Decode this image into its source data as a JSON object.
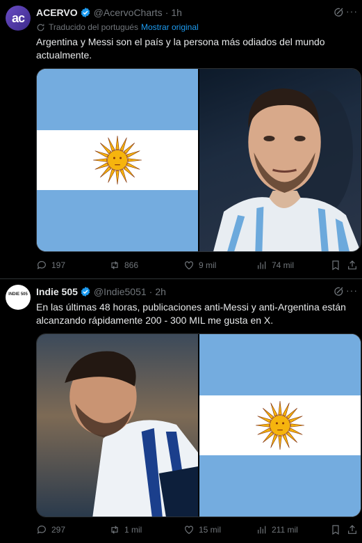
{
  "tweets": [
    {
      "avatar_text": "ac",
      "name": "ACERVO",
      "handle": "@AcervoCharts",
      "separator": "·",
      "time": "1h",
      "translated_note": "Traducido del portugués",
      "translated_link": "Mostrar original",
      "text": "Argentina y Messi son el país y la persona más odiados del mundo actualmente.",
      "stats": {
        "replies": "197",
        "reposts": "866",
        "likes": "9 mil",
        "views": "74 mil"
      }
    },
    {
      "avatar_text": "INDIE 505",
      "name": "Indie 505",
      "handle": "@Indie5051",
      "separator": "·",
      "time": "2h",
      "text": "En las últimas 48 horas, publicaciones anti-Messi y anti-Argentina están alcanzando rápidamente 200 - 300 MIL me gusta en X.",
      "stats": {
        "replies": "297",
        "reposts": "1 mil",
        "likes": "15 mil",
        "views": "211 mil"
      }
    }
  ],
  "colors": {
    "background": "#000000",
    "accent": "#1d9bf0",
    "muted": "#71767b",
    "flag_blue": "#74acdf",
    "sun": "#f6b40e"
  },
  "icons": [
    "verified-badge-icon",
    "grok-icon",
    "more-icon",
    "translate-icon",
    "reply-icon",
    "repost-icon",
    "like-icon",
    "views-icon",
    "bookmark-icon",
    "share-icon"
  ]
}
